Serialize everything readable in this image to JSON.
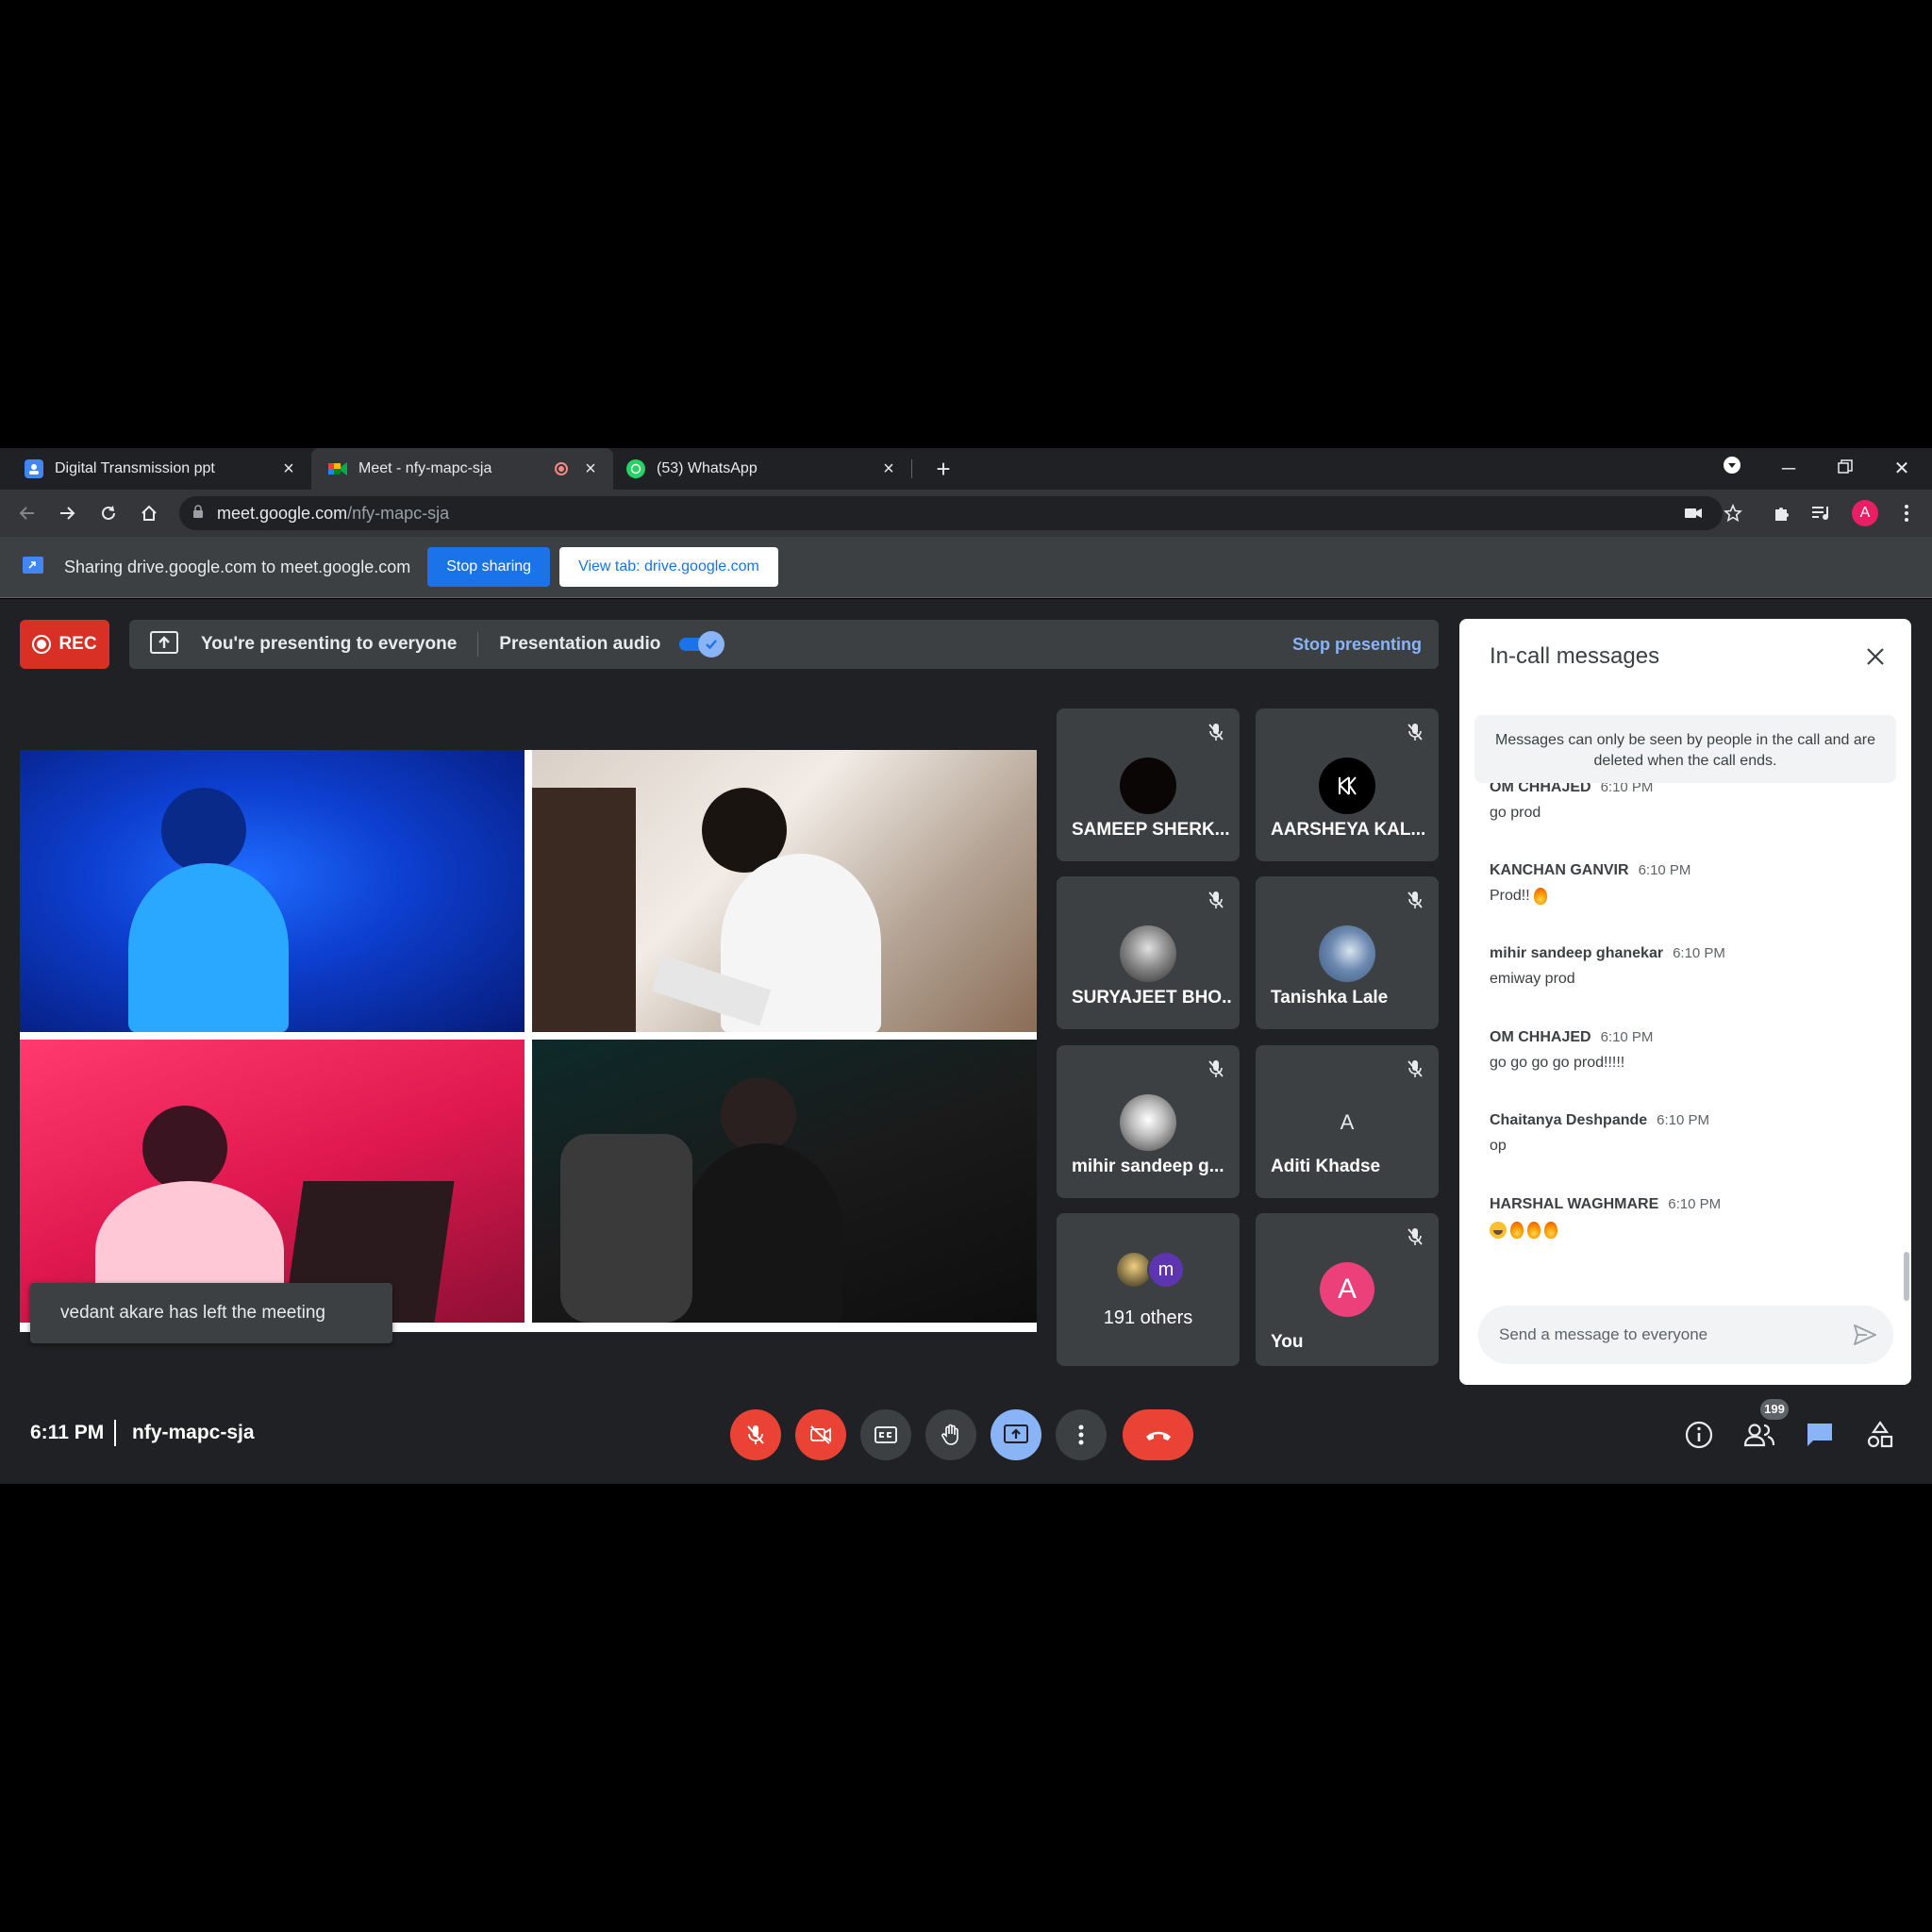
{
  "browser": {
    "tabs": [
      {
        "title": "Digital Transmission ppt",
        "favicon": "slides-icon"
      },
      {
        "title": "Meet - nfy-mapc-sja",
        "favicon": "meet-icon",
        "active": true,
        "recording": true
      },
      {
        "title": "(53) WhatsApp",
        "favicon": "whatsapp-icon"
      }
    ],
    "url_host": "meet.google.com",
    "url_path": "/nfy-mapc-sja",
    "profile_initial": "A"
  },
  "share_bar": {
    "text": "Sharing drive.google.com to meet.google.com",
    "stop_sharing": "Stop sharing",
    "view_tab": "View tab: drive.google.com"
  },
  "meet": {
    "rec_label": "REC",
    "presenting_text": "You're presenting to everyone",
    "presentation_audio_label": "Presentation audio",
    "presentation_audio_on": true,
    "stop_presenting": "Stop presenting",
    "toast": "vedant akare has left the meeting",
    "participants": [
      {
        "name": "SAMEEP SHERK...",
        "muted": true
      },
      {
        "name": "AARSHEYA KAL...",
        "muted": true
      },
      {
        "name": "SURYAJEET BHO...",
        "muted": true
      },
      {
        "name": "Tanishka Lale",
        "muted": true
      },
      {
        "name": "mihir sandeep g...",
        "muted": true
      },
      {
        "name": "Aditi Khadse",
        "muted": true,
        "initial": "A"
      },
      {
        "name": "You",
        "muted": true,
        "initial": "A"
      }
    ],
    "others": {
      "label": "191 others",
      "avatar_letter": "m"
    },
    "clock": "6:11 PM",
    "meeting_code": "nfy-mapc-sja",
    "people_count": "199"
  },
  "chat": {
    "title": "In-call messages",
    "notice": "Messages can only be seen by people in the call and are deleted when the call ends.",
    "messages": [
      {
        "sender": "OM CHHAJED",
        "time": "6:10 PM",
        "text": "go prod"
      },
      {
        "sender": "KANCHAN GANVIR",
        "time": "6:10 PM",
        "text": "Prod!!"
      },
      {
        "sender": "mihir sandeep ghanekar",
        "time": "6:10 PM",
        "text": "emiway prod"
      },
      {
        "sender": "OM CHHAJED",
        "time": "6:10 PM",
        "text": "go go go go prod!!!!!"
      },
      {
        "sender": "Chaitanya Deshpande",
        "time": "6:10 PM",
        "text": "op"
      },
      {
        "sender": "HARSHAL WAGHMARE",
        "time": "6:10 PM",
        "text": ""
      }
    ],
    "input_placeholder": "Send a message to everyone"
  },
  "colors": {
    "meet_bg": "#202124",
    "tile_bg": "#3c4043",
    "red": "#ea4335",
    "blue_accent": "#8ab4f8",
    "primary_blue": "#1a73e8"
  }
}
